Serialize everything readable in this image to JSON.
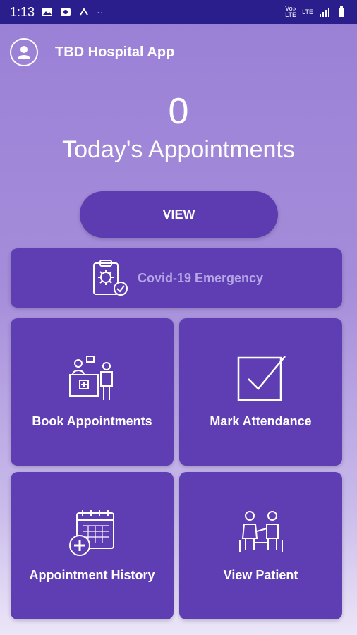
{
  "status_bar": {
    "time": "1:13",
    "network_1": "Vo» LTE",
    "network_2": "LTE"
  },
  "header": {
    "app_title": "TBD Hospital App",
    "avatar_icon": "user-avatar-icon"
  },
  "summary": {
    "count": "0",
    "label": "Today's Appointments"
  },
  "view_button": {
    "label": "VIEW"
  },
  "covid_card": {
    "label": "Covid-19 Emergency",
    "icon": "clipboard-virus-icon"
  },
  "tiles": [
    {
      "label": "Book Appointments",
      "icon": "reception-desk-icon"
    },
    {
      "label": "Mark Attendance",
      "icon": "checkbox-icon"
    },
    {
      "label": "Appointment History",
      "icon": "calendar-medical-icon"
    },
    {
      "label": "View Patient",
      "icon": "doctor-patient-icon"
    }
  ],
  "colors": {
    "status_bar": "#2a1e8c",
    "card": "#5f3db2",
    "button": "#5d3bb0",
    "background_top": "#9a80d6"
  }
}
